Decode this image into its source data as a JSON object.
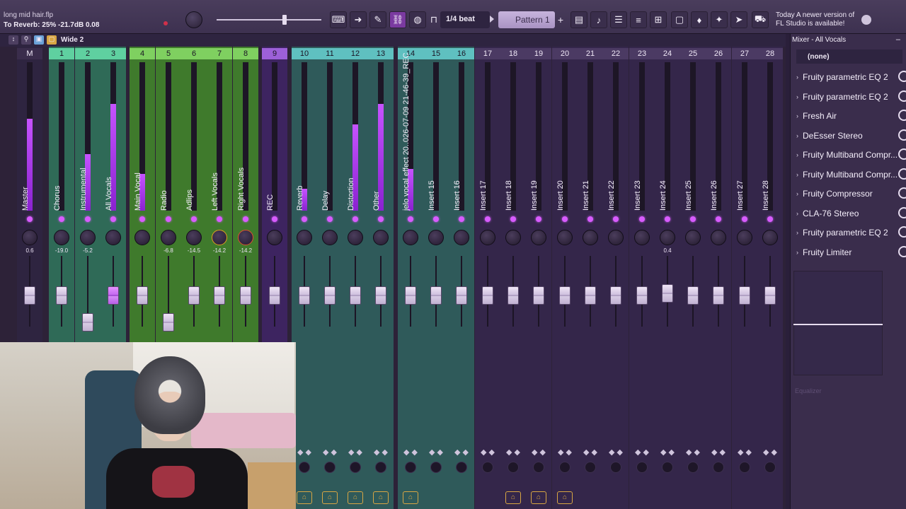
{
  "app": {
    "project_file": "long mid hair.flp",
    "hint_text": "To Reverb: 25%  -21.7dB  0.08"
  },
  "toolbar": {
    "snap_label": "1/4 beat",
    "pattern_label": "Pattern 1",
    "add_pattern": "+",
    "news_line1": "Today  A newer version of",
    "news_line2": "FL Studio is available!"
  },
  "mixer": {
    "view_mode": "Wide 2",
    "header_c": "C",
    "header_m": "M",
    "tracks": [
      {
        "num": "M",
        "label": "Master",
        "pan": "0.6",
        "color": "#2e2440",
        "meter": 0.62,
        "fader_level": 0.93
      },
      {
        "num": "1",
        "label": "Chorus",
        "pan": "-19.0",
        "color": "#2f6a57",
        "meter": 0.0,
        "fader_level": 0.93
      },
      {
        "num": "2",
        "label": "Instrumental",
        "pan": "-5.2",
        "color": "#2f6a57",
        "meter": 0.38,
        "fader_level": 0.55
      },
      {
        "num": "3",
        "label": "All Vocals",
        "pan": "",
        "color": "#2f6a57",
        "meter": 0.72,
        "fader_level": 0.93
      },
      {
        "num": "4",
        "label": "Main Vocal",
        "pan": "",
        "color": "#3f7a2c",
        "meter": 0.25,
        "fader_level": 0.93
      },
      {
        "num": "5",
        "label": "Radio",
        "pan": "-6.8",
        "color": "#3f7a2c",
        "meter": 0.0,
        "fader_level": 0.55
      },
      {
        "num": "6",
        "label": "Adlips",
        "pan": "-14.5",
        "color": "#3f7a2c",
        "meter": 0.0,
        "fader_level": 0.93
      },
      {
        "num": "7",
        "label": "Left Vocals",
        "pan": "-14.2",
        "color": "#3f7a2c",
        "meter": 0.0,
        "fader_level": 0.93
      },
      {
        "num": "8",
        "label": "Right Vocals",
        "pan": "-14.2",
        "color": "#3f7a2c",
        "meter": 0.0,
        "fader_level": 0.93
      },
      {
        "num": "9",
        "label": "REC",
        "pan": "",
        "color": "#3d2460",
        "meter": 0.0,
        "fader_level": 0.93
      },
      {
        "num": "10",
        "label": "Reverb",
        "pan": "",
        "color": "#2f5a5a",
        "meter": 0.15,
        "fader_level": 0.93
      },
      {
        "num": "11",
        "label": "Delay",
        "pan": "",
        "color": "#2f5a5a",
        "meter": 0.0,
        "fader_level": 0.93
      },
      {
        "num": "12",
        "label": "Distortion",
        "pan": "",
        "color": "#2f5a5a",
        "meter": 0.58,
        "fader_level": 0.93
      },
      {
        "num": "13",
        "label": "Other",
        "pan": "",
        "color": "#2f5a5a",
        "meter": 0.72,
        "fader_level": 0.93
      },
      {
        "num": "14",
        "label": "jelo vocal effect 20..026-07-09 21-46-39_REC",
        "pan": "",
        "color": "#2f5a5a",
        "meter": 0.28,
        "fader_level": 0.93
      },
      {
        "num": "15",
        "label": "Insert 15",
        "pan": "",
        "color": "#2f5a5a",
        "meter": 0.0,
        "fader_level": 0.93
      },
      {
        "num": "16",
        "label": "Insert 16",
        "pan": "",
        "color": "#2f5a5a",
        "meter": 0.0,
        "fader_level": 0.93
      },
      {
        "num": "17",
        "label": "Insert 17",
        "pan": "",
        "color": "#34264a",
        "meter": 0.0,
        "fader_level": 0.93
      },
      {
        "num": "18",
        "label": "Insert 18",
        "pan": "",
        "color": "#34264a",
        "meter": 0.0,
        "fader_level": 0.93
      },
      {
        "num": "19",
        "label": "Insert 19",
        "pan": "",
        "color": "#34264a",
        "meter": 0.0,
        "fader_level": 0.93
      },
      {
        "num": "20",
        "label": "Insert 20",
        "pan": "",
        "color": "#34264a",
        "meter": 0.0,
        "fader_level": 0.93
      },
      {
        "num": "21",
        "label": "Insert 21",
        "pan": "",
        "color": "#34264a",
        "meter": 0.0,
        "fader_level": 0.93
      },
      {
        "num": "22",
        "label": "Insert 22",
        "pan": "",
        "color": "#34264a",
        "meter": 0.0,
        "fader_level": 0.93
      },
      {
        "num": "23",
        "label": "Insert 23",
        "pan": "",
        "color": "#34264a",
        "meter": 0.0,
        "fader_level": 0.93
      },
      {
        "num": "24",
        "label": "Insert 24",
        "pan": "0.4",
        "color": "#34264a",
        "meter": 0.0,
        "fader_level": 0.96
      },
      {
        "num": "25",
        "label": "Insert 25",
        "pan": "",
        "color": "#34264a",
        "meter": 0.0,
        "fader_level": 0.93
      },
      {
        "num": "26",
        "label": "Insert 26",
        "pan": "",
        "color": "#34264a",
        "meter": 0.0,
        "fader_level": 0.93
      },
      {
        "num": "27",
        "label": "Insert 27",
        "pan": "",
        "color": "#34264a",
        "meter": 0.0,
        "fader_level": 0.93
      },
      {
        "num": "28",
        "label": "Insert 28",
        "pan": "",
        "color": "#34264a",
        "meter": 0.0,
        "fader_level": 0.93
      }
    ]
  },
  "panel": {
    "title": "Mixer - All Vocals",
    "close": "–",
    "input_label": "(none)",
    "slots": [
      "Fruity parametric EQ 2",
      "Fruity parametric EQ 2",
      "Fresh Air",
      "DeEsser Stereo",
      "Fruity Multiband Compr...",
      "Fruity Multiband Compr...",
      "Fruity Compressor",
      "CLA-76 Stereo",
      "Fruity parametric EQ 2",
      "Fruity Limiter"
    ],
    "eq_label": "Equalizer"
  },
  "icons": {
    "play": "play-icon",
    "link": "link-icon",
    "stamp": "stamp-icon",
    "typing": "typing-keyboard-icon",
    "pattern_add": "plus-icon"
  }
}
